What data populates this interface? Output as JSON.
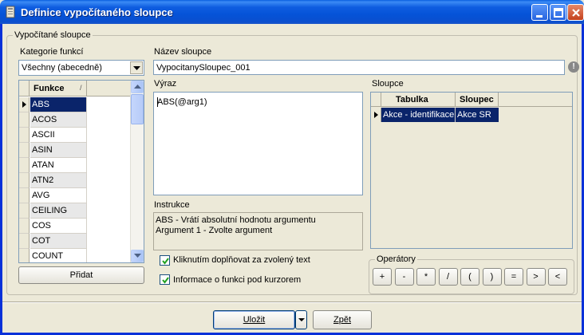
{
  "window": {
    "title": "Definice vypočítaného sloupce"
  },
  "group_title": "Vypočítané sloupce",
  "category": {
    "label": "Kategorie funkcí",
    "value": "Všechny (abecedně)"
  },
  "functions": {
    "column_header": "Funkce",
    "items": [
      "ABS",
      "ACOS",
      "ASCII",
      "ASIN",
      "ATAN",
      "ATN2",
      "AVG",
      "CEILING",
      "COS",
      "COT",
      "COUNT"
    ],
    "add_button": "Přidat"
  },
  "column_name": {
    "label": "Název sloupce",
    "value": "VypocitanySloupec_001"
  },
  "expression": {
    "label": "Výraz",
    "value": "ABS(@arg1)"
  },
  "instructions": {
    "label": "Instrukce",
    "line1": "ABS - Vrátí absolutní hodnotu argumentu",
    "line2": "Argument 1 - Zvolte argument"
  },
  "columns": {
    "label": "Sloupce",
    "headers": [
      "Tabulka",
      "Sloupec"
    ],
    "rows": [
      {
        "table": "Akce - identifikace",
        "column": "Akce SR"
      }
    ]
  },
  "options": {
    "double_click": {
      "label": "Kliknutím doplňovat za zvolený text",
      "checked": true
    },
    "info_under_cursor": {
      "label": "Informace o funkci pod kurzorem",
      "checked": true
    }
  },
  "operators": {
    "label": "Operátory",
    "items": [
      "+",
      "-",
      "*",
      "/",
      "(",
      ")",
      "=",
      ">",
      "<"
    ]
  },
  "footer": {
    "save": "Uložit",
    "back": "Zpět"
  }
}
